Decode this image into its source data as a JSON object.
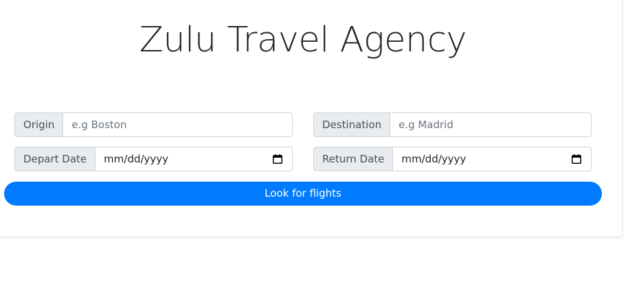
{
  "header": {
    "title": "Zulu Travel Agency"
  },
  "form": {
    "origin": {
      "label": "Origin",
      "placeholder": "e.g Boston"
    },
    "destination": {
      "label": "Destination",
      "placeholder": "e.g Madrid"
    },
    "depart": {
      "label": "Depart Date",
      "value": "mm/dd/yyyy",
      "icon": "calendar-icon"
    },
    "return": {
      "label": "Return Date",
      "value": "mm/dd/yyyy",
      "icon": "calendar-icon"
    },
    "submit_label": "Look for flights"
  },
  "colors": {
    "accent": "#007bff",
    "addon_bg": "#e9ecef",
    "border": "#ced4da",
    "placeholder": "#6c757d"
  }
}
